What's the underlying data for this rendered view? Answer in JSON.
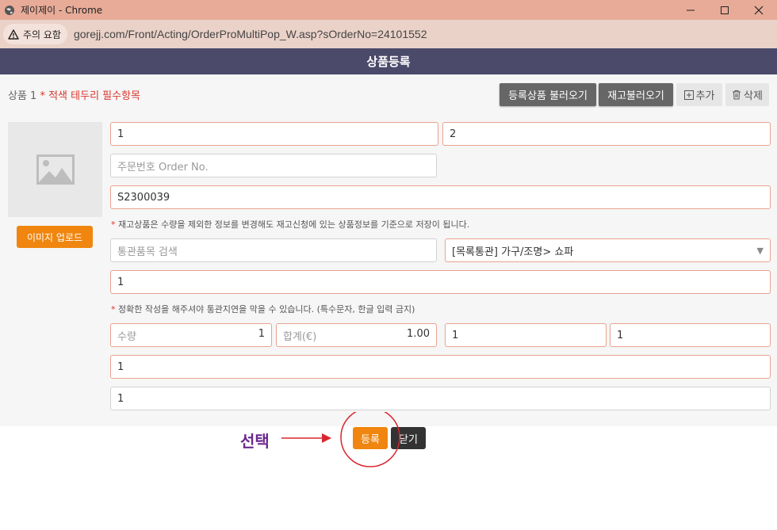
{
  "window": {
    "title": "제이제이 - Chrome"
  },
  "addressbar": {
    "warning_label": "주의 요함",
    "url": "gorejj.com/Front/Acting/OrderProMultiPop_W.asp?sOrderNo=24101552"
  },
  "header": {
    "title": "상품등록"
  },
  "product": {
    "label": "상품 1",
    "required_note": "* 적색 테두리 필수항목",
    "buttons": {
      "load_registered": "등록상품 불러오기",
      "load_stock": "재고불러오기",
      "add": "추가",
      "delete": "삭제"
    },
    "upload_label": "이미지 업로드",
    "fields": {
      "field1": "1",
      "field2": "2",
      "order_no_placeholder": "주문번호 Order No.",
      "stock_code": "S2300039",
      "customs_search_placeholder": "통관품목 검색",
      "category_select": "[목록통관] 가구/조명> 쇼파",
      "field_row5": "1",
      "qty_label": "수량",
      "qty_value": "1",
      "total_label": "합계(€)",
      "total_value": "1.00",
      "field_b": "1",
      "field_c": "1",
      "field_row8": "1",
      "field_row9": "1"
    },
    "note1": "재고상품은 수량을 제외한 정보를 변경해도 재고신청에 있는 상품정보를 기준으로 저장이 됩니다.",
    "note2": "정확한 작성을 해주셔야 통관지연을 막을 수 있습니다. (특수문자, 한글 입력 금지)"
  },
  "actions": {
    "register": "등록",
    "close": "닫기"
  },
  "annotation": {
    "label": "선택"
  },
  "colors": {
    "accent": "#f0860f",
    "header": "#4b4a6b",
    "required_border": "#e9a28f",
    "annotation": "#d9262e"
  }
}
